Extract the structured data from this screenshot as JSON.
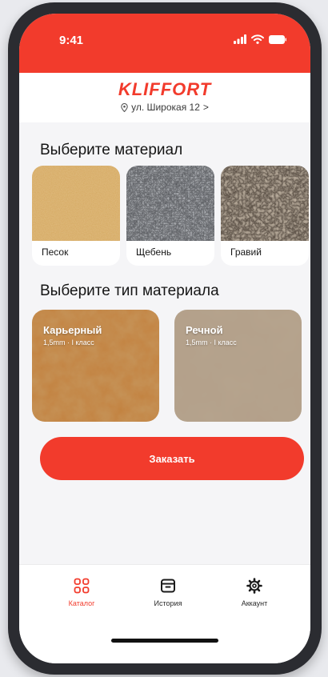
{
  "status_bar": {
    "time": "9:41"
  },
  "header": {
    "brand": "KLIFFORT",
    "address": "ул. Широкая 12",
    "address_chevron": ">"
  },
  "materials": {
    "title": "Выберите материал",
    "items": [
      {
        "label": "Песок",
        "image": "sand-texture"
      },
      {
        "label": "Щебень",
        "image": "crushed-stone-texture"
      },
      {
        "label": "Гравий",
        "image": "gravel-texture"
      }
    ]
  },
  "types": {
    "title": "Выберите тип материала",
    "items": [
      {
        "name": "Карьерный",
        "spec": "1,5mm · I класс",
        "image": "quarry-sand-texture"
      },
      {
        "name": "Речной",
        "spec": "1,5mm · I класс",
        "image": "river-sand-texture"
      }
    ]
  },
  "order_button": {
    "label": "Заказать"
  },
  "tab_bar": {
    "items": [
      {
        "label": "Каталог",
        "icon": "grid-icon",
        "active": true
      },
      {
        "label": "История",
        "icon": "box-icon",
        "active": false
      },
      {
        "label": "Аккаунт",
        "icon": "gear-icon",
        "active": false
      }
    ]
  },
  "colors": {
    "accent": "#f23b2c",
    "background": "#f5f5f7",
    "frame": "#2b2c31",
    "text": "#151515"
  }
}
